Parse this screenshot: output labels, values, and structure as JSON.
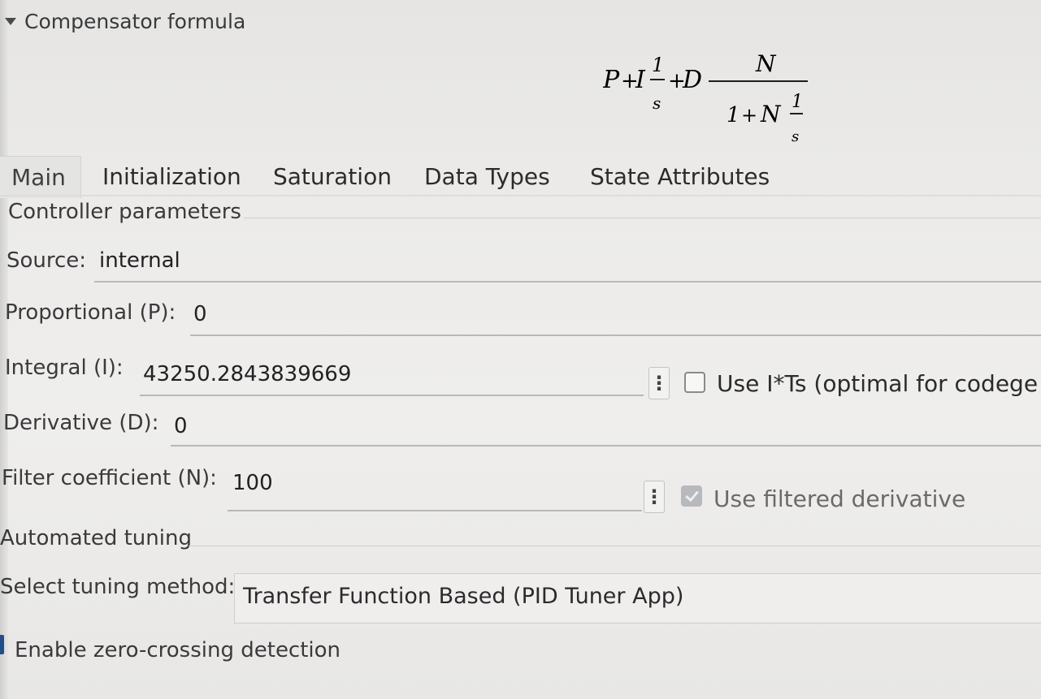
{
  "section": {
    "title": "Compensator formula"
  },
  "formula": {
    "P": "P",
    "plus1": "+",
    "I": "I",
    "one1": "1",
    "s1": "s",
    "plus2": "+",
    "D": "D",
    "N_num": "N",
    "den_one": "1",
    "den_plus": "+",
    "den_N": "N",
    "one2": "1",
    "s2": "s"
  },
  "tabs": [
    {
      "label": "Main",
      "active": true
    },
    {
      "label": "Initialization",
      "active": false
    },
    {
      "label": "Saturation",
      "active": false
    },
    {
      "label": "Data Types",
      "active": false
    },
    {
      "label": "State Attributes",
      "active": false
    }
  ],
  "controller_parameters": {
    "heading": "Controller parameters",
    "source_label": "Source:",
    "source_value": "internal",
    "proportional_label": "Proportional (P):",
    "proportional_value": "0",
    "integral_label": "Integral (I):",
    "integral_value": "43250.2843839669",
    "use_its_label": "Use I*Ts (optimal for codege",
    "use_its_checked": false,
    "derivative_label": "Derivative (D):",
    "derivative_value": "0",
    "filter_label": "Filter coefficient (N):",
    "filter_value": "100",
    "use_filtered_label": "Use filtered derivative",
    "use_filtered_checked": true,
    "ellipsis": "⋮"
  },
  "automated_tuning": {
    "heading": "Automated tuning",
    "method_label": "Select tuning method:",
    "method_value": "Transfer Function Based (PID Tuner App)"
  },
  "zero_crossing": {
    "label": "Enable zero-crossing detection",
    "checked": true
  }
}
